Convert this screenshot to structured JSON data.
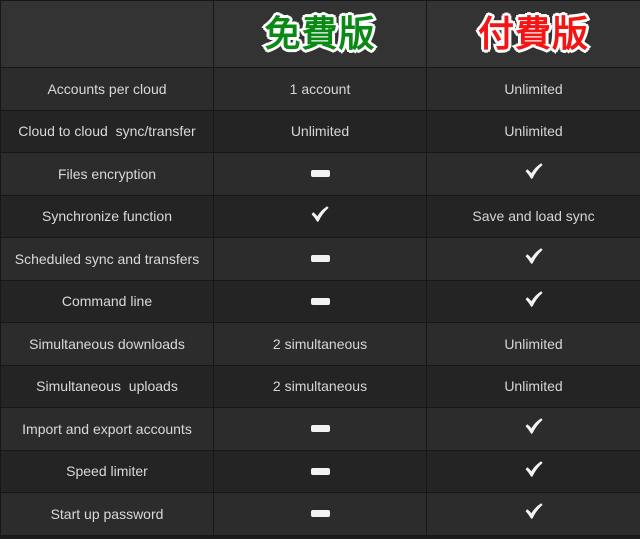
{
  "table": {
    "header": {
      "feature_label": "",
      "free_label": "免費版",
      "paid_label": "付費版",
      "free_color": "#0a8a14",
      "paid_color": "#f41414",
      "outline_color": "#ffffff",
      "background": "#333333"
    },
    "columns": [
      "",
      "免費版",
      "付費版"
    ],
    "markers": {
      "check": "check-mark",
      "dash": "dash-mark"
    },
    "rows": [
      {
        "feature": "Accounts per cloud",
        "free": {
          "type": "text",
          "value": "1 account"
        },
        "paid": {
          "type": "text",
          "value": "Unlimited"
        }
      },
      {
        "feature": "Cloud to cloud  sync/transfer",
        "free": {
          "type": "text",
          "value": "Unlimited"
        },
        "paid": {
          "type": "text",
          "value": "Unlimited"
        }
      },
      {
        "feature": "Files encryption",
        "free": {
          "type": "dash",
          "value": ""
        },
        "paid": {
          "type": "check",
          "value": ""
        }
      },
      {
        "feature": "Synchronize function",
        "free": {
          "type": "check",
          "value": ""
        },
        "paid": {
          "type": "text",
          "value": "Save and load sync"
        }
      },
      {
        "feature": "Scheduled sync and transfers",
        "free": {
          "type": "dash",
          "value": ""
        },
        "paid": {
          "type": "check",
          "value": ""
        }
      },
      {
        "feature": "Command line",
        "free": {
          "type": "dash",
          "value": ""
        },
        "paid": {
          "type": "check",
          "value": ""
        }
      },
      {
        "feature": "Simultaneous downloads",
        "free": {
          "type": "text",
          "value": "2 simultaneous"
        },
        "paid": {
          "type": "text",
          "value": "Unlimited"
        }
      },
      {
        "feature": "Simultaneous  uploads",
        "free": {
          "type": "text",
          "value": "2 simultaneous"
        },
        "paid": {
          "type": "text",
          "value": "Unlimited"
        }
      },
      {
        "feature": "Import and export accounts",
        "free": {
          "type": "dash",
          "value": ""
        },
        "paid": {
          "type": "check",
          "value": ""
        }
      },
      {
        "feature": "Speed limiter",
        "free": {
          "type": "dash",
          "value": ""
        },
        "paid": {
          "type": "check",
          "value": ""
        }
      },
      {
        "feature": "Start up password",
        "free": {
          "type": "dash",
          "value": ""
        },
        "paid": {
          "type": "check",
          "value": ""
        }
      }
    ]
  },
  "theme": {
    "page_background": "#1b1b1b",
    "row_odd_background": "#2c2c2c",
    "row_even_background": "#242424",
    "border_color": "#171717",
    "text_color": "#d6d6d6",
    "marker_color": "#f2f2f2"
  }
}
